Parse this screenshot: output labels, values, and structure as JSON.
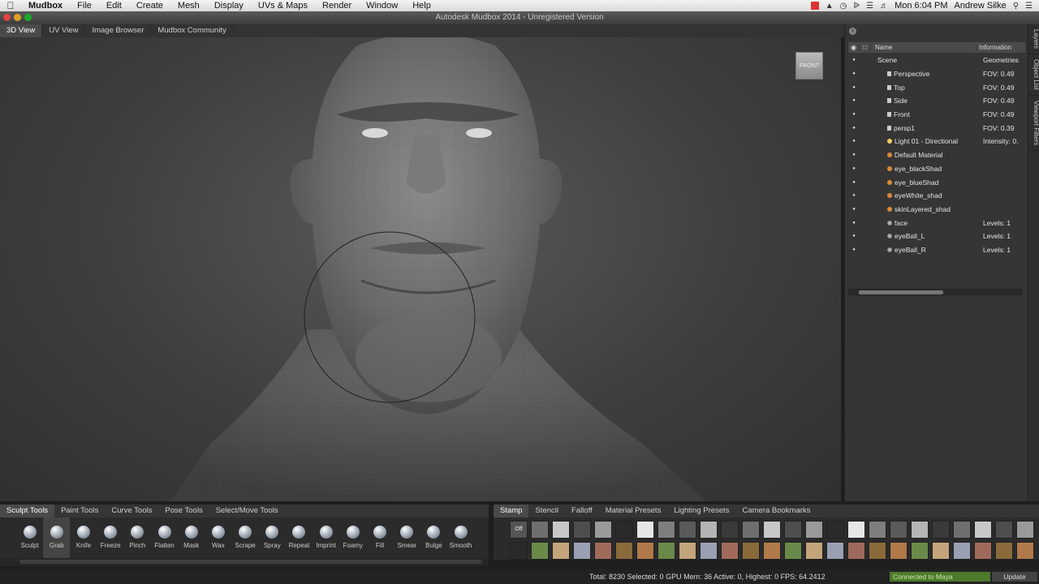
{
  "mac_menu": {
    "app": "Mudbox",
    "items": [
      "File",
      "Edit",
      "Create",
      "Mesh",
      "Display",
      "UVs & Maps",
      "Render",
      "Window",
      "Help"
    ],
    "clock": "Mon 6:04 PM",
    "user": "Andrew Silke"
  },
  "window": {
    "title": "Autodesk Mudbox 2014 - Unregistered Version"
  },
  "view_tabs": [
    "3D View",
    "UV View",
    "Image Browser",
    "Mudbox Community"
  ],
  "viewport": {
    "camera_cube_label": "FRONT"
  },
  "object_list": {
    "columns": {
      "name": "Name",
      "info": "Information"
    },
    "rows": [
      {
        "name": "Scene",
        "info": "Geometries",
        "icon": "none",
        "indent": 0
      },
      {
        "name": "Perspective",
        "info": "FOV: 0.49",
        "icon": "camera",
        "indent": 1
      },
      {
        "name": "Top",
        "info": "FOV: 0.49",
        "icon": "camera",
        "indent": 1
      },
      {
        "name": "Side",
        "info": "FOV: 0.49",
        "icon": "camera",
        "indent": 1
      },
      {
        "name": "Front",
        "info": "FOV: 0.49",
        "icon": "camera",
        "indent": 1
      },
      {
        "name": "persp1",
        "info": "FOV: 0.39",
        "icon": "camera",
        "indent": 1
      },
      {
        "name": "Light 01 - Directional",
        "info": "Intensity: 0.",
        "icon": "light",
        "indent": 1
      },
      {
        "name": "Default Material",
        "info": "",
        "icon": "material",
        "indent": 1
      },
      {
        "name": "eye_blackShad",
        "info": "",
        "icon": "material",
        "indent": 1
      },
      {
        "name": "eye_blueShad",
        "info": "",
        "icon": "material",
        "indent": 1
      },
      {
        "name": "eyeWhite_shad",
        "info": "",
        "icon": "material",
        "indent": 1
      },
      {
        "name": "skinLayered_shad",
        "info": "",
        "icon": "material",
        "indent": 1
      },
      {
        "name": "face",
        "info": "Levels: 1",
        "icon": "geometry",
        "indent": 1
      },
      {
        "name": "eyeBall_L",
        "info": "Levels: 1",
        "icon": "geometry",
        "indent": 1
      },
      {
        "name": "eyeBall_R",
        "info": "Levels: 1",
        "icon": "geometry",
        "indent": 1
      }
    ]
  },
  "side_tabs": [
    "Layers",
    "Object List",
    "Viewport Filters"
  ],
  "tool_tabs": [
    "Sculpt Tools",
    "Paint Tools",
    "Curve Tools",
    "Pose Tools",
    "Select/Move Tools"
  ],
  "tools": [
    "Sculpt",
    "Grab",
    "Knife",
    "Freeze",
    "Pinch",
    "Flatten",
    "Mask",
    "Wax",
    "Scrape",
    "Spray",
    "Repeat",
    "Imprint",
    "Foamy",
    "Fill",
    "Smear",
    "Bulge",
    "Smooth"
  ],
  "active_tool": "Grab",
  "stamp_tabs": [
    "Stamp",
    "Stencil",
    "Falloff",
    "Material Presets",
    "Lighting Presets",
    "Camera Bookmarks"
  ],
  "stamp_off_label": "Off",
  "status": {
    "stats": "Total: 8230  Selected: 0 GPU Mem: 36  Active: 0, Highest: 0  FPS: 64.2412",
    "maya": "Connected to Maya",
    "update": "Update"
  },
  "colors": {
    "accent_green": "#4c7a2a",
    "viewport_bg": "#3e3e3e"
  }
}
